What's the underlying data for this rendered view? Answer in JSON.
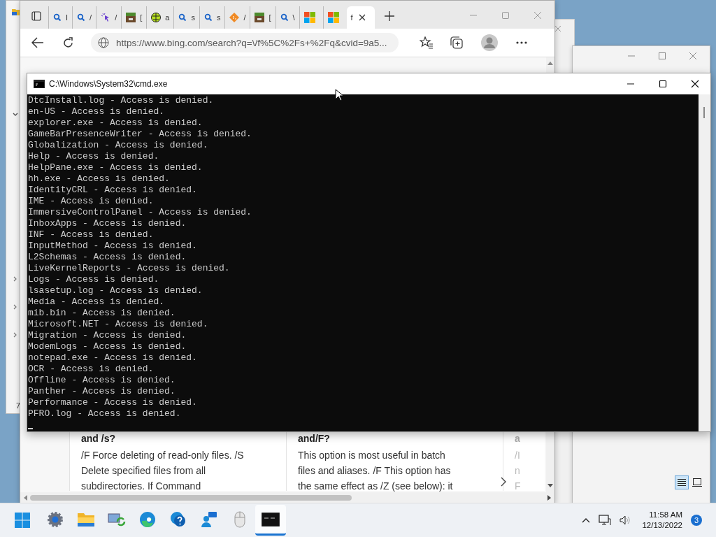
{
  "explorer_behind": {
    "number": "7"
  },
  "browser": {
    "tabs": [
      {
        "kind": "search",
        "title": "I",
        "selected": false
      },
      {
        "kind": "search",
        "title": "/",
        "selected": false
      },
      {
        "kind": "cursor",
        "title": "/",
        "selected": false
      },
      {
        "kind": "block",
        "title": "[",
        "selected": false
      },
      {
        "kind": "ball",
        "title": "a",
        "selected": false
      },
      {
        "kind": "search",
        "title": "s",
        "selected": false
      },
      {
        "kind": "search",
        "title": "s",
        "selected": false
      },
      {
        "kind": "diamond",
        "title": "/",
        "selected": false
      },
      {
        "kind": "block",
        "title": "[",
        "selected": false
      },
      {
        "kind": "search",
        "title": "\\",
        "selected": false
      },
      {
        "kind": "windows",
        "selected": false
      },
      {
        "kind": "windows",
        "selected": false
      },
      {
        "kind": "plain",
        "title": "f",
        "selected": true
      }
    ],
    "address": "https://www.bing.com/search?q=\\/f%5C%2Fs+%2Fq&cvid=9a5...",
    "cards": [
      {
        "kind": "full",
        "heading": "and /s?",
        "lines": [
          "/F Force deleting of read-only files. /S",
          "Delete specified files from all",
          "subdirectories. If Command"
        ]
      },
      {
        "kind": "full",
        "heading": "and/F?",
        "lines": [
          "This option is most useful in batch",
          "files and aliases. /F This option has",
          "the same effect as /Z (see below): it"
        ]
      },
      {
        "kind": "cut",
        "heading": "a",
        "lines": [
          "/I",
          "n",
          "F"
        ]
      }
    ]
  },
  "window_behind": {
    "view_buttons": [
      {
        "kind": "details",
        "selected": true
      },
      {
        "kind": "preview",
        "selected": false
      }
    ]
  },
  "cmd": {
    "title": "C:\\Windows\\System32\\cmd.exe",
    "lines": [
      "DtcInstall.log - Access is denied.",
      "en-US - Access is denied.",
      "explorer.exe - Access is denied.",
      "GameBarPresenceWriter - Access is denied.",
      "Globalization - Access is denied.",
      "Help - Access is denied.",
      "HelpPane.exe - Access is denied.",
      "hh.exe - Access is denied.",
      "IdentityCRL - Access is denied.",
      "IME - Access is denied.",
      "ImmersiveControlPanel - Access is denied.",
      "InboxApps - Access is denied.",
      "INF - Access is denied.",
      "InputMethod - Access is denied.",
      "L2Schemas - Access is denied.",
      "LiveKernelReports - Access is denied.",
      "Logs - Access is denied.",
      "lsasetup.log - Access is denied.",
      "Media - Access is denied.",
      "mib.bin - Access is denied.",
      "Microsoft.NET - Access is denied.",
      "Migration - Access is denied.",
      "ModemLogs - Access is denied.",
      "notepad.exe - Access is denied.",
      "OCR - Access is denied.",
      "Offline - Access is denied.",
      "Panther - Access is denied.",
      "Performance - Access is denied.",
      "PFRO.log - Access is denied."
    ]
  },
  "taskbar": {
    "apps": [
      {
        "kind": "settings",
        "selected": false
      },
      {
        "kind": "folder",
        "selected": false
      },
      {
        "kind": "network",
        "selected": false
      },
      {
        "kind": "edge",
        "selected": false
      },
      {
        "kind": "help",
        "selected": false
      },
      {
        "kind": "chat",
        "selected": false
      },
      {
        "kind": "mouse",
        "selected": false
      },
      {
        "kind": "terminal",
        "selected": true
      }
    ],
    "time": "11:58 AM",
    "date": "12/13/2022",
    "notifications": "3"
  }
}
